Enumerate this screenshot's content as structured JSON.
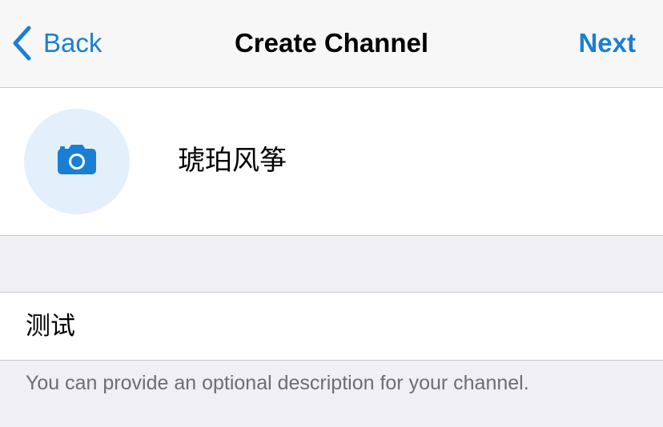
{
  "navbar": {
    "back_label": "Back",
    "title": "Create Channel",
    "next_label": "Next"
  },
  "profile": {
    "avatar_icon": "camera-icon",
    "channel_name": "琥珀风筝"
  },
  "description": {
    "value": "测试",
    "hint": "You can provide an optional description for your channel."
  },
  "colors": {
    "accent": "#1a7fd4",
    "avatar_bg": "#e3effb",
    "background": "#efeff4"
  }
}
